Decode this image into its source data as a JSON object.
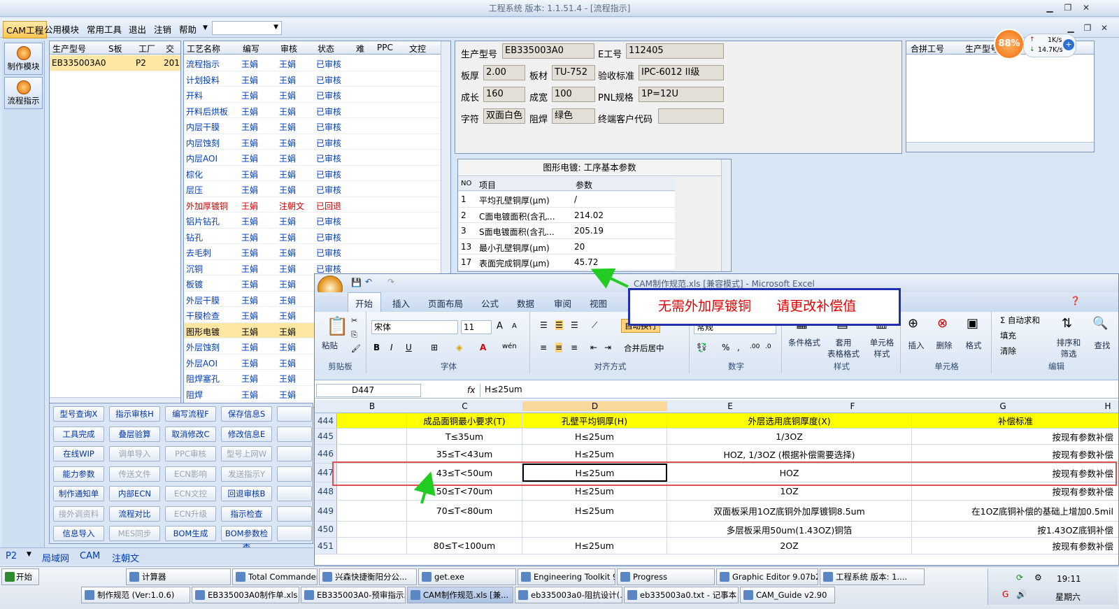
{
  "window": {
    "title": "工程系统  版本: 1.1.51.4 - [流程指示]"
  },
  "menu": {
    "items": [
      "CAM工程",
      "公用模块",
      "常用工具",
      "退出",
      "注销",
      "帮助"
    ]
  },
  "left_toolbar": {
    "items": [
      "制作模块",
      "流程指示"
    ]
  },
  "product_grid": {
    "headers": [
      "生产型号",
      "S板",
      "工厂",
      "交货"
    ],
    "rows": [
      [
        "EB335003A0",
        "",
        "P2",
        "201"
      ]
    ]
  },
  "process_grid": {
    "headers": [
      "工艺名称",
      "编写",
      "审核",
      "状态",
      "难",
      "PPC",
      "文控"
    ],
    "rows": [
      [
        "流程指示",
        "王娟",
        "王娟",
        "已审核"
      ],
      [
        "计划投料",
        "王娟",
        "王娟",
        "已审核"
      ],
      [
        "开料",
        "王娟",
        "王娟",
        "已审核"
      ],
      [
        "开料后烘板",
        "王娟",
        "王娟",
        "已审核"
      ],
      [
        "内层干膜",
        "王娟",
        "王娟",
        "已审核"
      ],
      [
        "内层蚀刻",
        "王娟",
        "王娟",
        "已审核"
      ],
      [
        "内层AOI",
        "王娟",
        "王娟",
        "已审核"
      ],
      [
        "棕化",
        "王娟",
        "王娟",
        "已审核"
      ],
      [
        "层压",
        "王娟",
        "王娟",
        "已审核"
      ],
      [
        "外加厚镀铜",
        "王娟",
        "注朝文",
        "已回退"
      ],
      [
        "铝片钻孔",
        "王娟",
        "王娟",
        "已审核"
      ],
      [
        "钻孔",
        "王娟",
        "王娟",
        "已审核"
      ],
      [
        "去毛刺",
        "王娟",
        "王娟",
        "已审核"
      ],
      [
        "沉铜",
        "王娟",
        "王娟",
        "已审核"
      ],
      [
        "板镀",
        "王娟",
        "王娟",
        ""
      ],
      [
        "外层干膜",
        "王娟",
        "王娟",
        ""
      ],
      [
        "干膜检查",
        "王娟",
        "王娟",
        ""
      ],
      [
        "图形电镀",
        "王娟",
        "王娟",
        ""
      ],
      [
        "外层蚀刻",
        "王娟",
        "王娟",
        ""
      ],
      [
        "外层AOI",
        "王娟",
        "王娟",
        ""
      ],
      [
        "阻焊塞孔",
        "王娟",
        "王娟",
        ""
      ],
      [
        "阻焊",
        "王娟",
        "王娟",
        ""
      ]
    ]
  },
  "action_buttons": [
    [
      "型号查询X",
      "指示审核H",
      "编写流程F",
      "保存信息S"
    ],
    [
      "工具完成",
      "叠层验算",
      "取消修改C",
      "修改信息E"
    ],
    [
      "在线WIP",
      "调单导入",
      "PPC审核",
      "型号上网W"
    ],
    [
      "能力参数",
      "传送文件",
      "ECN影响",
      "发送指示Y"
    ],
    [
      "制作通知单",
      "内部ECN",
      "ECN文控",
      "回退审核B"
    ],
    [
      "接外调资料",
      "流程对比",
      "ECN升级",
      "指示检查"
    ],
    [
      "信息导入",
      "MES同步",
      "BOM生成",
      "BOM参数检查"
    ]
  ],
  "disabled_buttons": [
    "调单导入",
    "PPC审核",
    "型号上网W",
    "传送文件",
    "ECN影响",
    "发送指示Y",
    "ECN文控",
    "接外调资料",
    "ECN升级",
    "MES同步"
  ],
  "bottom_tabs": [
    "P2",
    "局域网",
    "CAM",
    "注朝文"
  ],
  "info": {
    "prod_label": "生产型号",
    "prod": "EB335003A0",
    "e_label": "E工号",
    "e": "112405",
    "thick_label": "板厚",
    "thick": "2.00",
    "mat_label": "板材",
    "mat": "TU-752",
    "std_label": "验收标准",
    "std": "IPC-6012 II级",
    "len_label": "成长",
    "len": "160",
    "wid_label": "成宽",
    "wid": "100",
    "pnl_label": "PNL规格",
    "pnl": "1P=12U",
    "char_label": "字符",
    "char": "双面白色",
    "mask_label": "阻焊",
    "mask": "绿色",
    "cust_label": "终端客户代码",
    "cust": ""
  },
  "merge_grid": {
    "headers": [
      "合拼工号",
      "生产型号"
    ]
  },
  "net": {
    "pct": "88%",
    "up": "1K/s",
    "down": "14.7K/s"
  },
  "param_table": {
    "title": "图形电镀: 工序基本参数",
    "headers": [
      "NO",
      "项目",
      "参数"
    ],
    "rows": [
      [
        "1",
        "平均孔壁铜厚(μm)",
        "/"
      ],
      [
        "2",
        "C面电镀面积(含孔...",
        "214.02"
      ],
      [
        "3",
        "S面电镀面积(含孔...",
        "205.19"
      ],
      [
        "13",
        "最小孔壁铜厚(μm)",
        "20"
      ],
      [
        "17",
        "表面完成铜厚(μm)",
        "45.72"
      ]
    ]
  },
  "excel": {
    "title": "CAM制作规范.xls [兼容模式] - Microsoft Excel",
    "tabs": [
      "开始",
      "插入",
      "页面布局",
      "公式",
      "数据",
      "审阅",
      "视图"
    ],
    "font": "宋体",
    "size": "11",
    "groups": [
      "剪贴板",
      "字体",
      "对齐方式",
      "数字",
      "样式",
      "单元格",
      "编辑"
    ],
    "buttons": {
      "paste": "粘贴",
      "wrap": "自动换行",
      "merge": "合并后居中",
      "fmt": "常规",
      "cond": "条件格式",
      "table": "套用\n表格格式",
      "cellstyle": "单元格\n样式",
      "insert": "插入",
      "delete": "删除",
      "format": "格式",
      "sum": "Σ 自动求和",
      "fill": "填充",
      "clear": "清除",
      "sort": "排序和\n筛选",
      "find": "查找"
    },
    "cellref": "D447",
    "formula": "H≤25um",
    "cols": [
      "B",
      "C",
      "D",
      "E",
      "F",
      "G",
      "H"
    ],
    "rows": [
      {
        "n": "444",
        "c": "成品面铜最小要求(T)",
        "d": "孔壁平均铜厚(H)",
        "e": "外层选用底铜厚度(X)",
        "g": "补偿标准"
      },
      {
        "n": "445",
        "c": "T≤35um",
        "d": "H≤25um",
        "e": "1/3OZ",
        "g": "按现有参数补偿"
      },
      {
        "n": "446",
        "c": "35≤T<43um",
        "d": "H≤25um",
        "e": "HOZ, 1/3OZ (根据补偿需要选择)",
        "g": "按现有参数补偿"
      },
      {
        "n": "447",
        "c": "43≤T<50um",
        "d": "H≤25um",
        "e": "HOZ",
        "g": "按现有参数补偿"
      },
      {
        "n": "448",
        "c": "50≤T<70um",
        "d": "H≤25um",
        "e": "1OZ",
        "g": "按现有参数补偿"
      },
      {
        "n": "449",
        "c": "70≤T<80um",
        "d": "H≤25um",
        "e": "双面板采用1OZ底铜外加厚镀铜8.5um",
        "g": "在1OZ底铜补偿的基础上增加0.5mil"
      },
      {
        "n": "450",
        "c": "",
        "d": "",
        "e": "多层板采用50um(1.43OZ)铜箔",
        "g": "按1.43OZ底铜补偿"
      },
      {
        "n": "451",
        "c": "80≤T<100um",
        "d": "H≤25um",
        "e": "2OZ",
        "g": "按现有参数补偿"
      }
    ]
  },
  "callout": {
    "text": "无需外加厚镀铜      请更改补偿值"
  },
  "taskbar": {
    "start": "开始",
    "row1": [
      "计算器",
      "Total Commander 7.0...",
      "兴森快捷衡阳分公...",
      "get.exe",
      "Engineering Toolkit 9....",
      "Progress",
      "Graphic Editor 9.07b2...",
      "工程系统  版本: 1...."
    ],
    "row2": [
      "制作规范 (Ver:1.0.6)",
      "EB335003A0制作单.xls",
      "EB335003A0-预审指示...",
      "CAM制作规范.xls [兼...",
      "eb335003a0-阻抗设计(...",
      "eb335003a0.txt - 记事本",
      "CAM_Guide v2.90"
    ],
    "time": "19:11",
    "day": "星期六"
  },
  "colors": {
    "accent": "#ffc550",
    "selected": "#fde7a3",
    "yellow": "#ffff00",
    "red": "#d20000",
    "link": "#003cba"
  }
}
